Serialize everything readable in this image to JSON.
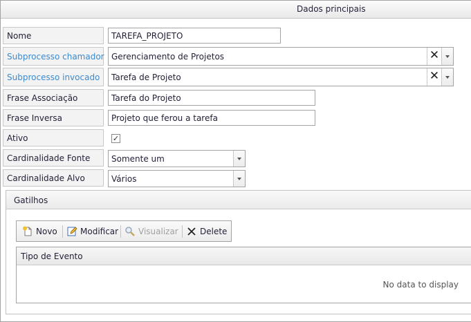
{
  "header": {
    "title": "Dados principais"
  },
  "form": {
    "nome": {
      "label": "Nome",
      "value": "TAREFA_PROJETO"
    },
    "subprocesso_chamador": {
      "label": "Subprocesso chamador",
      "value": "Gerenciamento de Projetos"
    },
    "subprocesso_invocado": {
      "label": "Subprocesso invocado",
      "value": "Tarefa de Projeto"
    },
    "frase_associacao": {
      "label": "Frase Associação",
      "value": "Tarefa do Projeto"
    },
    "frase_inversa": {
      "label": "Frase Inversa",
      "value": "Projeto que ferou a tarefa"
    },
    "ativo": {
      "label": "Ativo",
      "checked": true,
      "check_glyph": "✓"
    },
    "cardinalidade_fonte": {
      "label": "Cardinalidade Fonte",
      "value": "Somente um"
    },
    "cardinalidade_alvo": {
      "label": "Cardinalidade Alvo",
      "value": "Vários"
    }
  },
  "gatilhos": {
    "title": "Gatilhos",
    "toolbar": {
      "novo": "Novo",
      "modificar": "Modificar",
      "visualizar": "Visualizar",
      "delete": "Delete"
    },
    "grid": {
      "columns": [
        "Tipo de Evento"
      ],
      "empty_text": "No data to display"
    }
  },
  "icons": {
    "clear": "clear-x-icon",
    "dropdown": "chevron-down-icon",
    "novo": "new-document-icon",
    "modificar": "edit-icon",
    "visualizar": "magnifier-icon",
    "delete": "delete-x-icon"
  },
  "colors": {
    "link_label": "#3a8ad0",
    "disabled_text": "#a0a0a0"
  }
}
